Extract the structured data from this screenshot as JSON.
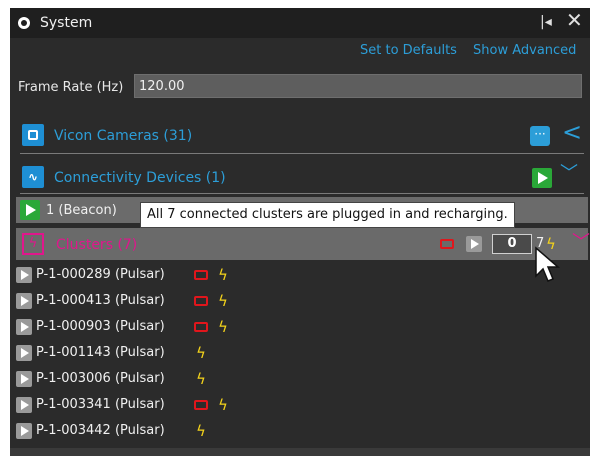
{
  "window": {
    "title": "System"
  },
  "links": {
    "defaults": "Set to Defaults",
    "advanced": "Show Advanced"
  },
  "frame_rate": {
    "label": "Frame Rate (Hz)",
    "value": "120.00"
  },
  "vicon_cameras": {
    "title": "Vicon Cameras (31)",
    "more_label": "···"
  },
  "connectivity": {
    "title": "Connectivity Devices (1)",
    "beacon_label": "1 (Beacon)"
  },
  "tooltip": {
    "text": "All 7 connected clusters are plugged in and recharging."
  },
  "clusters": {
    "title": "Clusters (7)",
    "count_value": "0",
    "count_total": "7",
    "items": [
      {
        "label": "P-1-000289 (Pulsar)",
        "battery_warning": true,
        "charging": true
      },
      {
        "label": "P-1-000413 (Pulsar)",
        "battery_warning": true,
        "charging": true
      },
      {
        "label": "P-1-000903 (Pulsar)",
        "battery_warning": true,
        "charging": true
      },
      {
        "label": "P-1-001143 (Pulsar)",
        "battery_warning": false,
        "charging": true
      },
      {
        "label": "P-1-003006 (Pulsar)",
        "battery_warning": false,
        "charging": true
      },
      {
        "label": "P-1-003341 (Pulsar)",
        "battery_warning": true,
        "charging": true
      },
      {
        "label": "P-1-003442 (Pulsar)",
        "battery_warning": false,
        "charging": true
      }
    ]
  },
  "colors": {
    "accent_blue": "#2c9ed8",
    "cluster_pink": "#e0168c",
    "play_green": "#2aa838",
    "battery_red": "#e0161c",
    "bolt_yellow": "#f3d21b"
  },
  "icons": {
    "title": "circle-icon",
    "pin": "pin-icon",
    "close": "close-icon",
    "vicon": "camera-grid-icon",
    "connectivity": "pulse-icon",
    "clusters": "bolt-square-icon",
    "bolt": "bolt-icon",
    "battery": "battery-icon"
  }
}
